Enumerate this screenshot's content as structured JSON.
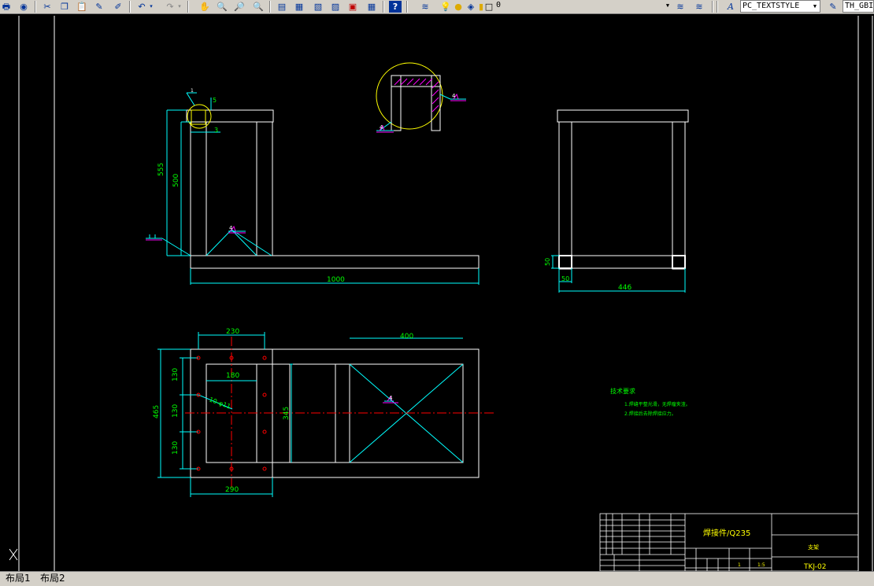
{
  "toolbar": {
    "textstyle_label": "PC_TEXTSTYLE",
    "dimstyle_label": "TH_GBI",
    "layer_value": "0"
  },
  "drawing": {
    "front_view": {
      "dim_total_height": "555",
      "dim_inner_height": "500",
      "dim_length": "1000",
      "dim_small_top": "5",
      "dim_small_side": "3",
      "weld_symbol_1": "4",
      "weld_symbol_2": "1"
    },
    "detail_view": {
      "weld_a": "4",
      "weld_b": "4"
    },
    "side_view": {
      "dim_width": "446",
      "dim_leg": "50",
      "dim_base_height": "50"
    },
    "top_view": {
      "dim_hole_span": "230",
      "dim_inner_span": "180",
      "dim_plate_length": "400",
      "dim_holes_width": "290",
      "dim_total_width": "465",
      "dim_pitch_1": "130",
      "dim_pitch_2": "130",
      "dim_pitch_3": "130",
      "dim_inner_height": "345",
      "hole_note": "10-φ11",
      "weld_symbol": "4"
    },
    "tech_requirements": {
      "title": "技术要求",
      "line1": "1.焊缝平整光滑，无焊瘤夹渣。",
      "line2": "2.焊接后去除焊接应力。"
    },
    "title_block": {
      "material": "焊接件/Q235",
      "part_name": "支架",
      "drawing_no": "TKJ-02",
      "scale": "1:5",
      "quantity": "1"
    }
  },
  "tabs": [
    {
      "label": "布局1"
    },
    {
      "label": "布局2"
    }
  ],
  "colors": {
    "background": "#000000",
    "geometry": "#ffffff",
    "dimension": "#00ffff",
    "dim_text": "#00ff00",
    "centerline": "#ff0000",
    "detail_circle": "#ffff00",
    "weld": "#ff00ff"
  }
}
